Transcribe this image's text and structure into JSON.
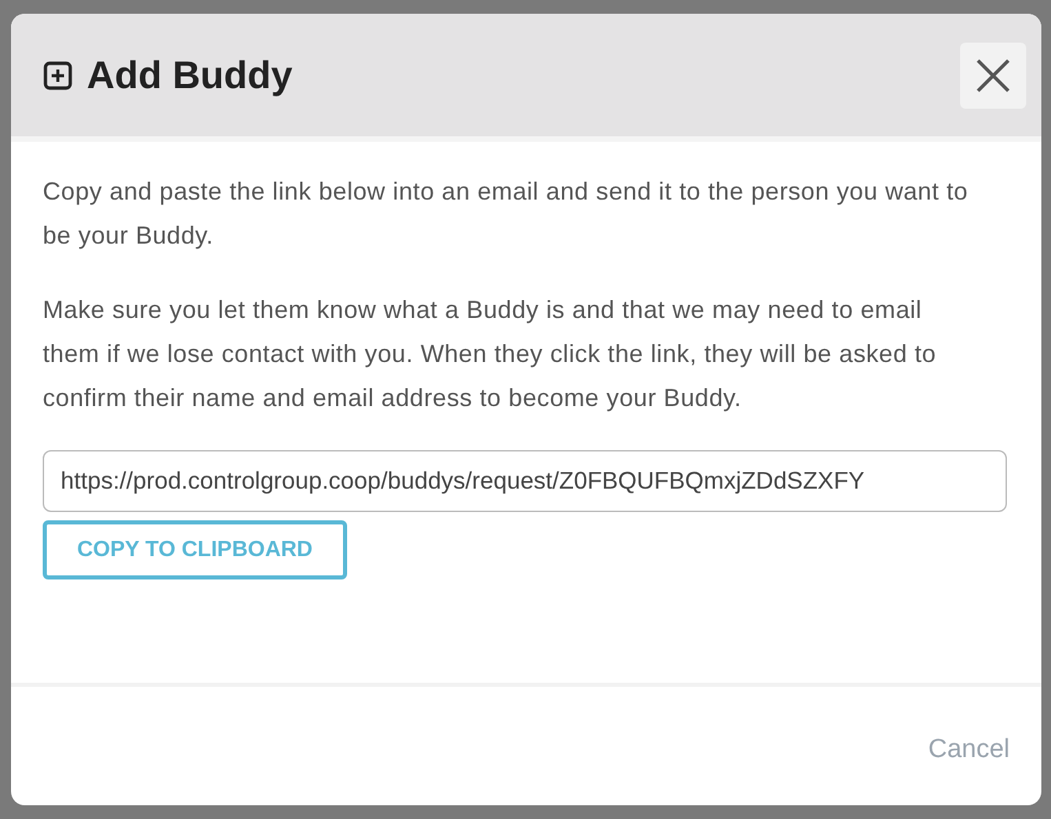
{
  "dialog": {
    "title": "Add Buddy",
    "paragraphs": [
      "Copy and paste the link below into an email and send it to the person you want to be your Buddy.",
      "Make sure you let them know what a Buddy is and that we may need to email them if we lose contact with you. When they click the link, they will be asked to confirm their name and email address to become your Buddy."
    ],
    "link_field": {
      "value": "https://prod.controlgroup.coop/buddys/request/Z0FBQUFBQmxjZDdSZXFY"
    },
    "copy_button": "COPY TO CLIPBOARD",
    "cancel_button": "Cancel"
  }
}
